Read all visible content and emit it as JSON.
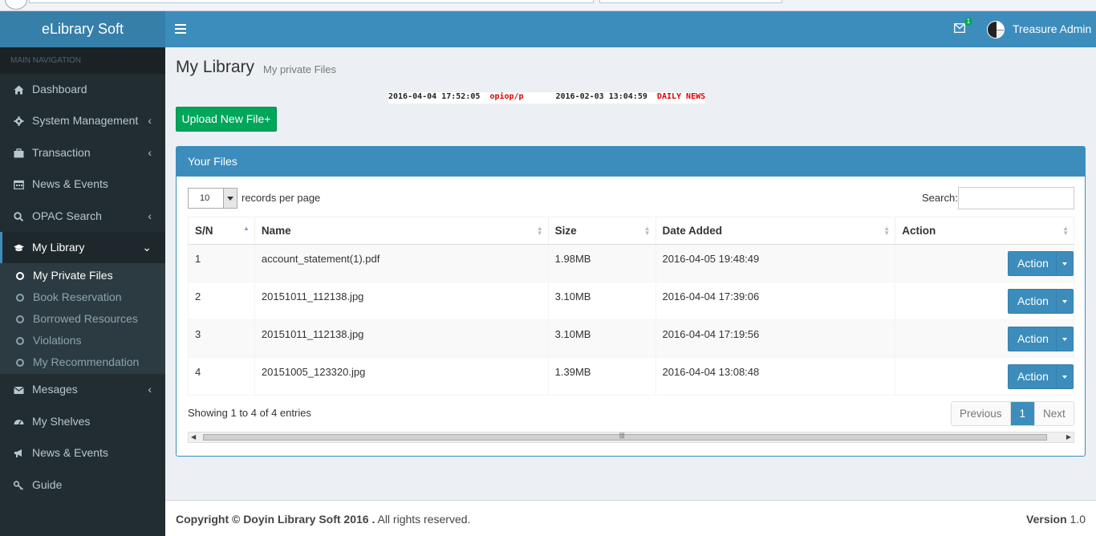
{
  "app": {
    "title": "eLibrary Soft"
  },
  "header": {
    "user_name": "Treasure Admin",
    "mail_badge": "1"
  },
  "sidebar": {
    "section_label": "MAIN NAVIGATION",
    "items": [
      {
        "label": "Dashboard"
      },
      {
        "label": "System Management"
      },
      {
        "label": "Transaction"
      },
      {
        "label": "News & Events"
      },
      {
        "label": "OPAC Search"
      },
      {
        "label": "My Library"
      },
      {
        "label": "Mesages"
      },
      {
        "label": "My Shelves"
      },
      {
        "label": "News & Events"
      },
      {
        "label": "Guide"
      }
    ],
    "sub_items": [
      {
        "label": "My Private Files"
      },
      {
        "label": "Book Reservation"
      },
      {
        "label": "Borrowed Resources"
      },
      {
        "label": "Violations"
      },
      {
        "label": "My Recommendation"
      }
    ]
  },
  "page": {
    "title": "My Library",
    "subtitle": "My private Files"
  },
  "ticker": [
    {
      "date": "2016-04-04 17:52:05",
      "text": "opiop/p"
    },
    {
      "date": "2016-02-03 13:04:59",
      "text": "DAILY NEWS"
    }
  ],
  "upload_label": "Upload New File+",
  "panel": {
    "title": "Your Files",
    "length_value": "10",
    "length_label": "records per page",
    "search_label": "Search:"
  },
  "table": {
    "columns": [
      "S/N",
      "Name",
      "Size",
      "Date Added",
      "Action"
    ],
    "rows": [
      {
        "sn": "1",
        "name": "account_statement(1).pdf",
        "size": "1.98MB",
        "date": "2016-04-05 19:48:49",
        "action": "Action"
      },
      {
        "sn": "2",
        "name": "20151011_112138.jpg",
        "size": "3.10MB",
        "date": "2016-04-04 17:39:06",
        "action": "Action"
      },
      {
        "sn": "3",
        "name": "20151011_112138.jpg",
        "size": "3.10MB",
        "date": "2016-04-04 17:19:56",
        "action": "Action"
      },
      {
        "sn": "4",
        "name": "20151005_123320.jpg",
        "size": "1.39MB",
        "date": "2016-04-04 13:08:48",
        "action": "Action"
      }
    ]
  },
  "footer_info": "Showing 1 to 4 of 4 entries",
  "pager": {
    "previous": "Previous",
    "page": "1",
    "next": "Next"
  },
  "footer": {
    "copyright": "Copyright © Doyin Library Soft 2016 .",
    "rights": "All rights reserved.",
    "version_label": "Version",
    "version_value": "1.0"
  },
  "colors": {
    "primary": "#3c8dbc",
    "logo": "#367fa9",
    "success": "#00a65a",
    "sidebar": "#222d32"
  }
}
